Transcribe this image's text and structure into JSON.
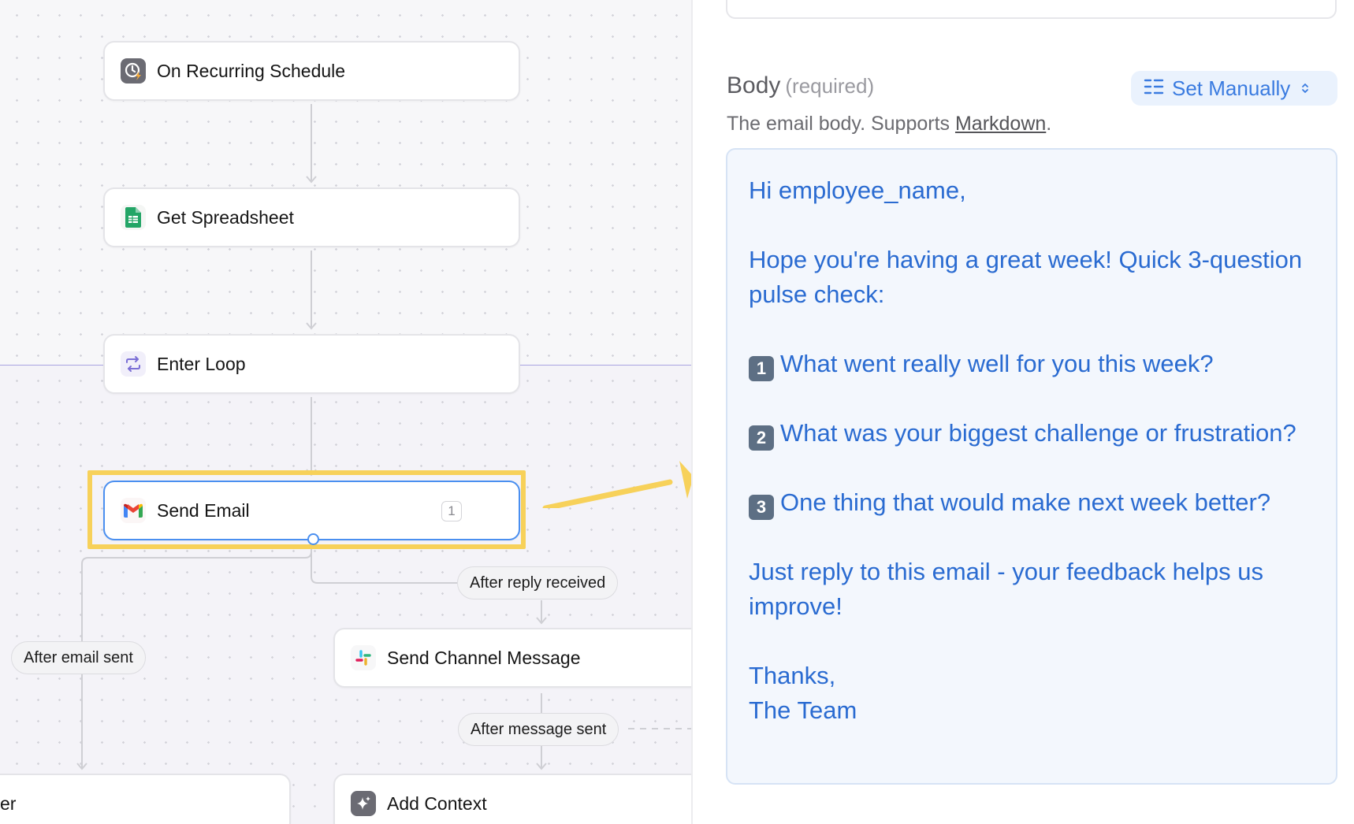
{
  "canvas": {
    "nodes": {
      "schedule": {
        "label": "On Recurring Schedule",
        "icon": "clock-bolt-icon"
      },
      "spreadsheet": {
        "label": "Get Spreadsheet",
        "icon": "google-sheets-icon"
      },
      "loop": {
        "label": "Enter Loop",
        "icon": "loop-icon"
      },
      "send_email": {
        "label": "Send Email",
        "icon": "gmail-icon",
        "badge": "1"
      },
      "channel_message": {
        "label": "Send Channel Message",
        "icon": "slack-icon"
      },
      "add_context": {
        "label": "Add Context",
        "icon": "sparkle-icon"
      },
      "partial_left": {
        "label": "er"
      }
    },
    "edge_labels": {
      "after_reply": "After reply received",
      "after_email": "After email sent",
      "after_message": "After message sent"
    },
    "colors": {
      "highlight": "#f7d15a",
      "selected_border": "#4a8ff0",
      "loop_line": "#a9a3e0"
    }
  },
  "panel": {
    "field_title": "Body",
    "required_label": "(required)",
    "mode_label": "Set Manually",
    "description_prefix": "The email body. Supports ",
    "description_link": "Markdown",
    "description_suffix": ".",
    "body": {
      "greeting": "Hi employee_name,",
      "intro": "Hope you're having a great week! Quick 3-question pulse check:",
      "q1_num": "1",
      "q1": "What went really well for you this week?",
      "q2_num": "2",
      "q2": "What was your biggest challenge or frustration?",
      "q3_num": "3",
      "q3": "One thing that would make next week better?",
      "closing": "Just reply to this email - your feedback helps us improve!",
      "signoff": "Thanks,",
      "signature": "The Team"
    },
    "colors": {
      "body_text": "#2a6bd1",
      "accent": "#3a7be0"
    }
  }
}
